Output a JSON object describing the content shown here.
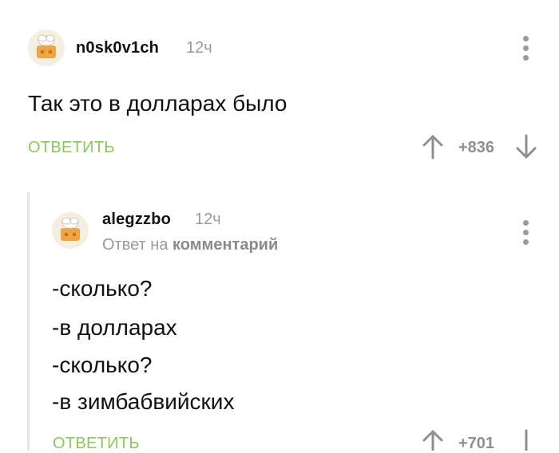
{
  "comment1": {
    "username": "n0sk0v1ch",
    "time": "12ч",
    "text": "Так это в долларах было",
    "reply_label": "ОТВЕТИТЬ",
    "score": "+836",
    "avatar_icon": "chef-avatar-icon"
  },
  "comment2": {
    "username": "alegzzbo",
    "time": "12ч",
    "reply_prefix": "Ответ на",
    "reply_target": "комментарий",
    "lines": [
      "-сколько?",
      "-в долларах",
      "-сколько?",
      "-в зимбабвийских"
    ],
    "reply_label": "ОТВЕТИТЬ",
    "score": "+701",
    "avatar_icon": "chef-avatar-icon"
  },
  "colors": {
    "accent_green": "#8ac858",
    "muted_gray": "#9a9a9a"
  }
}
